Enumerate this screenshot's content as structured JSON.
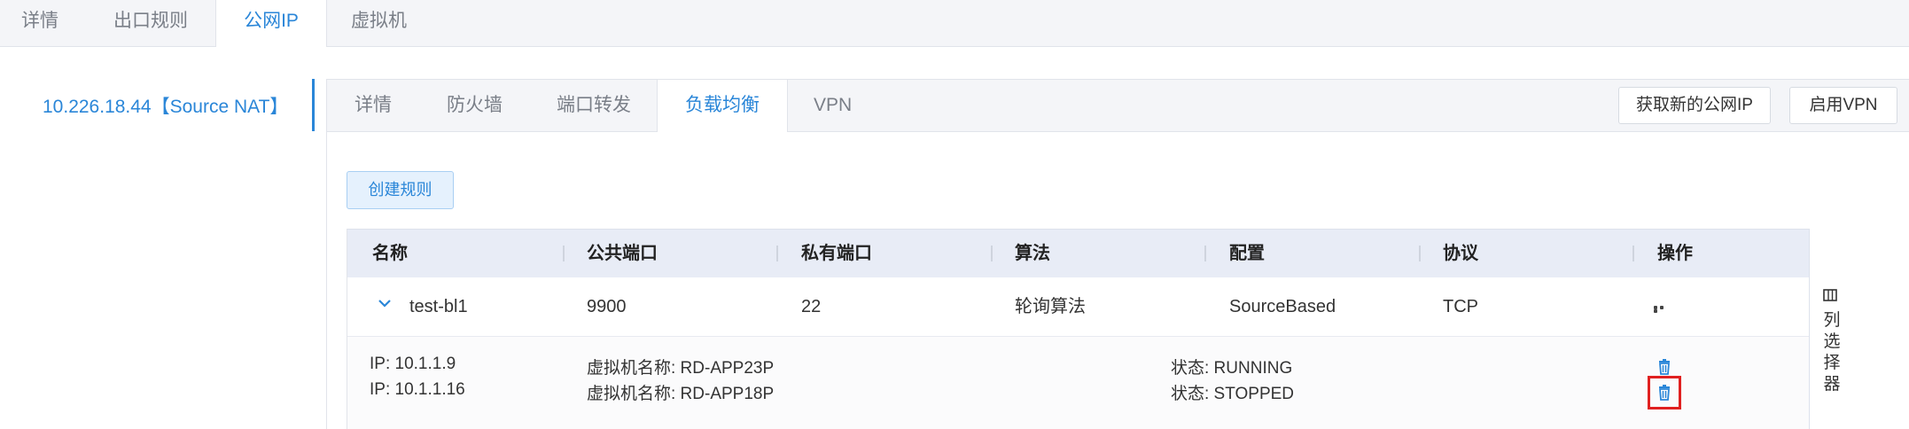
{
  "top_tabs": [
    {
      "label": "详情"
    },
    {
      "label": "出口规则"
    },
    {
      "label": "公网IP",
      "active": true
    },
    {
      "label": "虚拟机"
    }
  ],
  "ip_list": [
    {
      "label": "10.226.18.44【Source NAT】",
      "selected": true
    }
  ],
  "inner_tabs": [
    {
      "label": "详情"
    },
    {
      "label": "防火墙"
    },
    {
      "label": "端口转发"
    },
    {
      "label": "负载均衡",
      "active": true
    },
    {
      "label": "VPN"
    }
  ],
  "header_buttons": {
    "acquire_ip": "获取新的公网IP",
    "enable_vpn": "启用VPN"
  },
  "create_rule_button": "创建规则",
  "table": {
    "columns": [
      "名称",
      "公共端口",
      "私有端口",
      "算法",
      "配置",
      "协议",
      "操作"
    ],
    "rows": [
      {
        "name": "test-bl1",
        "public_port": "9900",
        "private_port": "22",
        "algorithm": "轮询算法",
        "config": "SourceBased",
        "protocol": "TCP",
        "expanded": true
      }
    ],
    "expanded_details": [
      {
        "ip": "IP: 10.1.1.9",
        "vm_name": "虚拟机名称: RD-APP23P",
        "status": "状态: RUNNING"
      },
      {
        "ip": "IP: 10.1.1.16",
        "vm_name": "虚拟机名称: RD-APP18P",
        "status": "状态: STOPPED"
      }
    ]
  },
  "column_chooser": {
    "label": "列选择器",
    "icon": "columns-icon"
  },
  "colors": {
    "accent": "#2a86d8",
    "highlight": "#e02020",
    "header_bg": "#e8ecf6"
  }
}
